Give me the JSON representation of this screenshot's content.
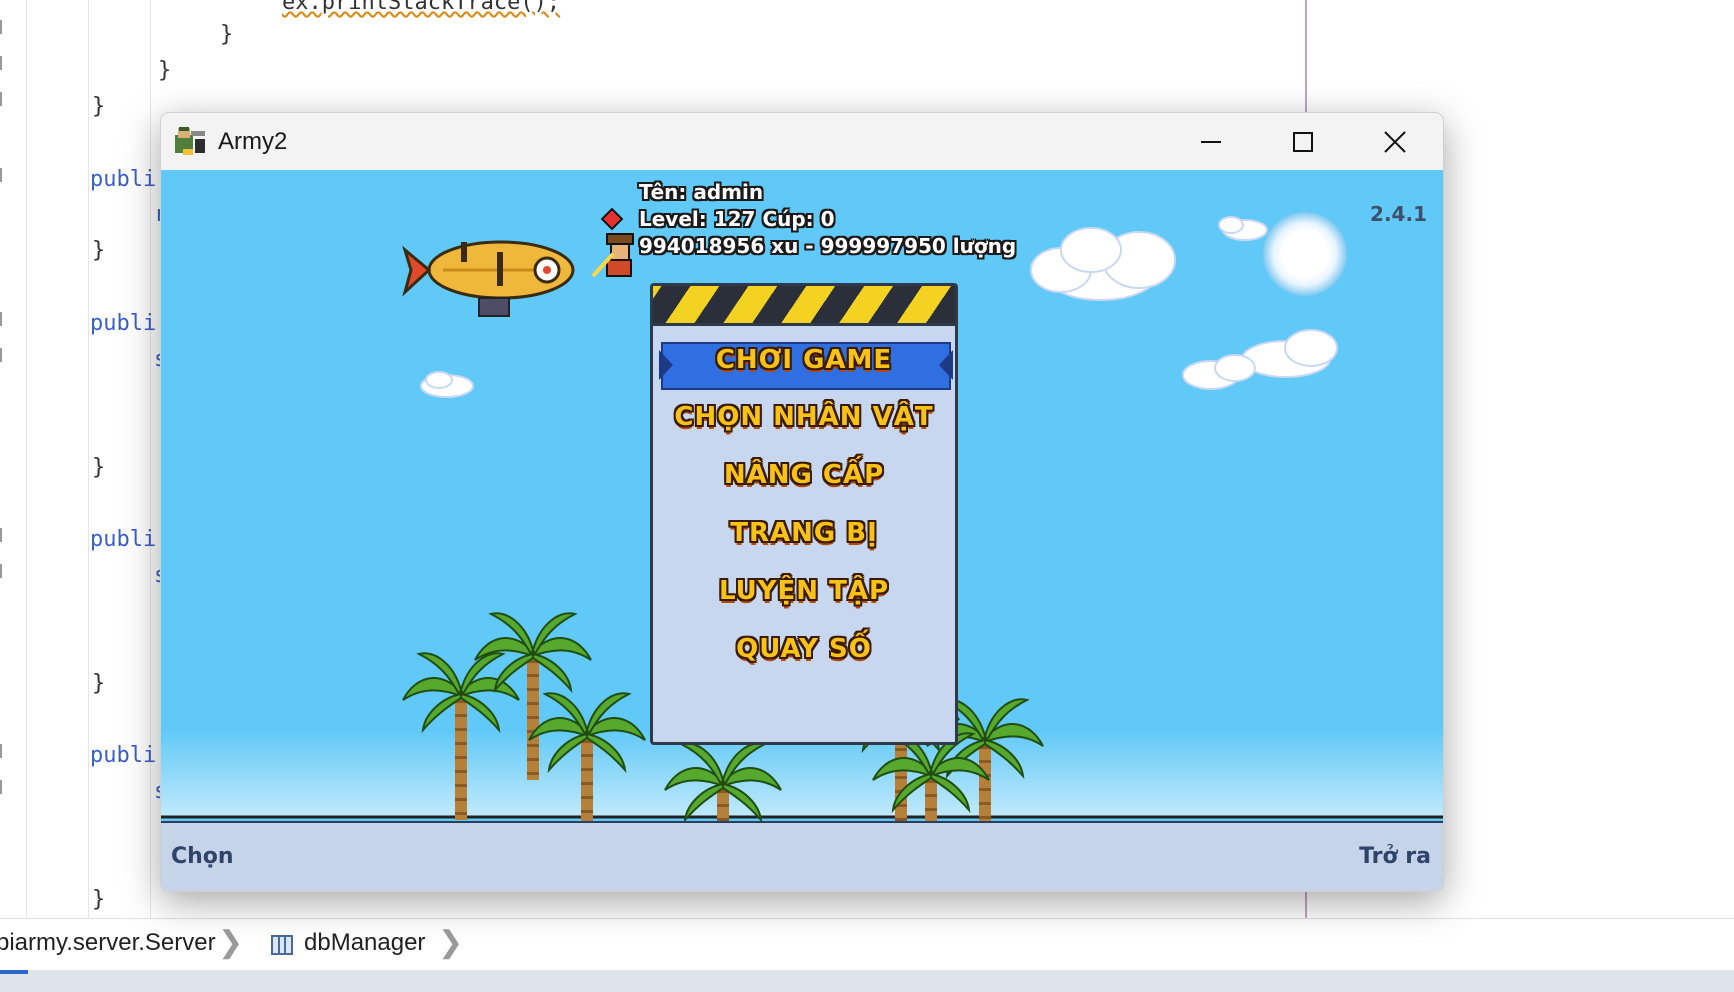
{
  "editor": {
    "code_lines": [
      "ex.printStackTrace();",
      "}",
      "}",
      "}",
      "publi",
      "r",
      "}",
      "publi",
      "s",
      "}",
      "publi",
      "s",
      "}",
      "publi",
      "s",
      "}"
    ]
  },
  "breadcrumb": {
    "items": [
      "piarmy.server.Server",
      "dbManager"
    ]
  },
  "window": {
    "title": "Army2",
    "controls": {
      "minimize": "minimize",
      "maximize": "maximize",
      "close": "close"
    }
  },
  "game": {
    "player_name": "Tên: admin",
    "level_line": "Level: 127    Cúp: 0",
    "currency_line": "994018956 xu - 999997950 lượng",
    "version": "2.4.1",
    "menu": {
      "selected_index": 0,
      "items": [
        "CHƠI GAME",
        "CHỌN NHÂN VẬT",
        "NÂNG CẤP",
        "TRANG BỊ",
        "LUYỆN TẬP",
        "QUAY SỐ"
      ]
    },
    "softkeys": {
      "left": "Chọn",
      "right": "Trở ra"
    }
  },
  "colors": {
    "sky": "#61c9f7",
    "menu_text": "#f8c316",
    "menu_highlight": "#2f6fe2",
    "softbar": "#c6d4ea"
  }
}
